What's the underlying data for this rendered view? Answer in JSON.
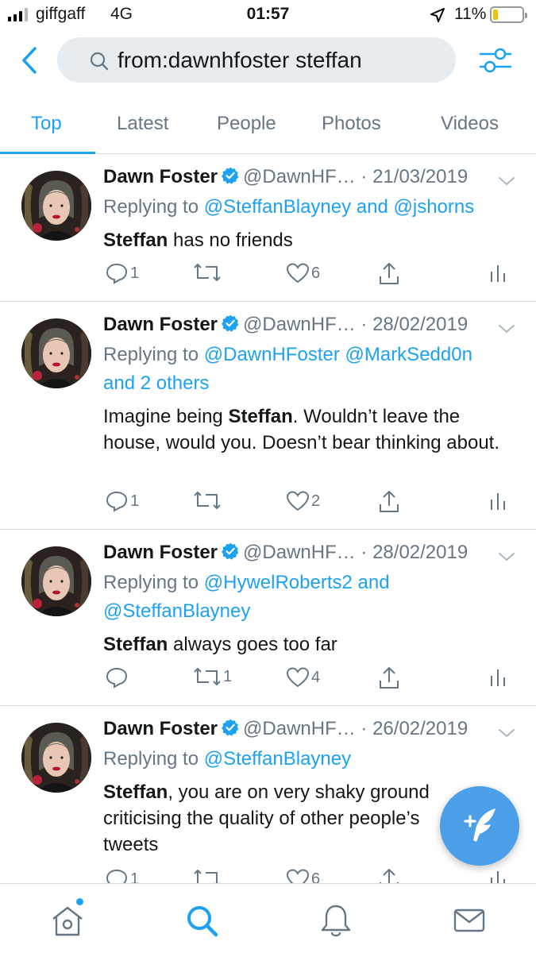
{
  "status_bar": {
    "carrier": "giffgaff",
    "network": "4G",
    "time": "01:57",
    "battery": "11%",
    "signal_strength": 3,
    "battery_level": 0.11,
    "battery_color": "#f2c200"
  },
  "search": {
    "query": "from:dawnhfoster steffan",
    "back_icon": "chevron-left-icon",
    "filter_icon": "sliders-icon"
  },
  "tabs": [
    {
      "label": "Top",
      "active": true
    },
    {
      "label": "Latest",
      "active": false
    },
    {
      "label": "People",
      "active": false
    },
    {
      "label": "Photos",
      "active": false
    },
    {
      "label": "Videos",
      "active": false
    }
  ],
  "tweets": [
    {
      "name": "Dawn Foster",
      "handle": "@DawnHF…",
      "date": "· 21/03/2019",
      "reply_prefix": "Replying to",
      "reply_mentions": "@SteffanBlayney and @jshorns",
      "reply_mentions_2": "",
      "text_bold": "Steffan",
      "text_rest": " has no friends",
      "replies": "1",
      "retweets": "",
      "likes": "6"
    },
    {
      "name": "Dawn Foster",
      "handle": "@DawnHF…",
      "date": "· 28/02/2019",
      "reply_prefix": "Replying to",
      "reply_mentions": "@DawnHFoster @MarkSedd0n",
      "reply_mentions_2": "and 2 others",
      "text_pre": "Imagine being ",
      "text_bold": "Steffan",
      "text_rest": ". Wouldn’t leave the house, would you. Doesn’t bear thinking about.",
      "replies": "1",
      "retweets": "",
      "likes": "2"
    },
    {
      "name": "Dawn Foster",
      "handle": "@DawnHF…",
      "date": "· 28/02/2019",
      "reply_prefix": "Replying to",
      "reply_mentions": "@HywelRoberts2 and",
      "reply_mentions_2": "@SteffanBlayney",
      "text_bold": "Steffan",
      "text_rest": " always goes too far",
      "replies": "",
      "retweets": "1",
      "likes": "4"
    },
    {
      "name": "Dawn Foster",
      "handle": "@DawnHF…",
      "date": "· 26/02/2019",
      "reply_prefix": "Replying to",
      "reply_mentions": "@SteffanBlayney",
      "reply_mentions_2": "",
      "text_bold": "Steffan",
      "text_rest": ", you are on very shaky ground criticising the quality of other people’s tweets",
      "replies": "1",
      "retweets": "",
      "likes": "6"
    }
  ],
  "fab": {
    "icon": "compose-tweet-icon"
  },
  "bottom_nav": [
    {
      "icon": "home-icon",
      "active": false
    },
    {
      "icon": "search-icon",
      "active": true
    },
    {
      "icon": "notifications-bell-icon",
      "active": false
    },
    {
      "icon": "messages-envelope-icon",
      "active": false
    }
  ],
  "colors": {
    "accent": "#1da1f2",
    "secondary_text": "#657786",
    "primary_text": "#14171a",
    "search_bg": "#e6ecf0",
    "fab": "#4a9fe8"
  }
}
